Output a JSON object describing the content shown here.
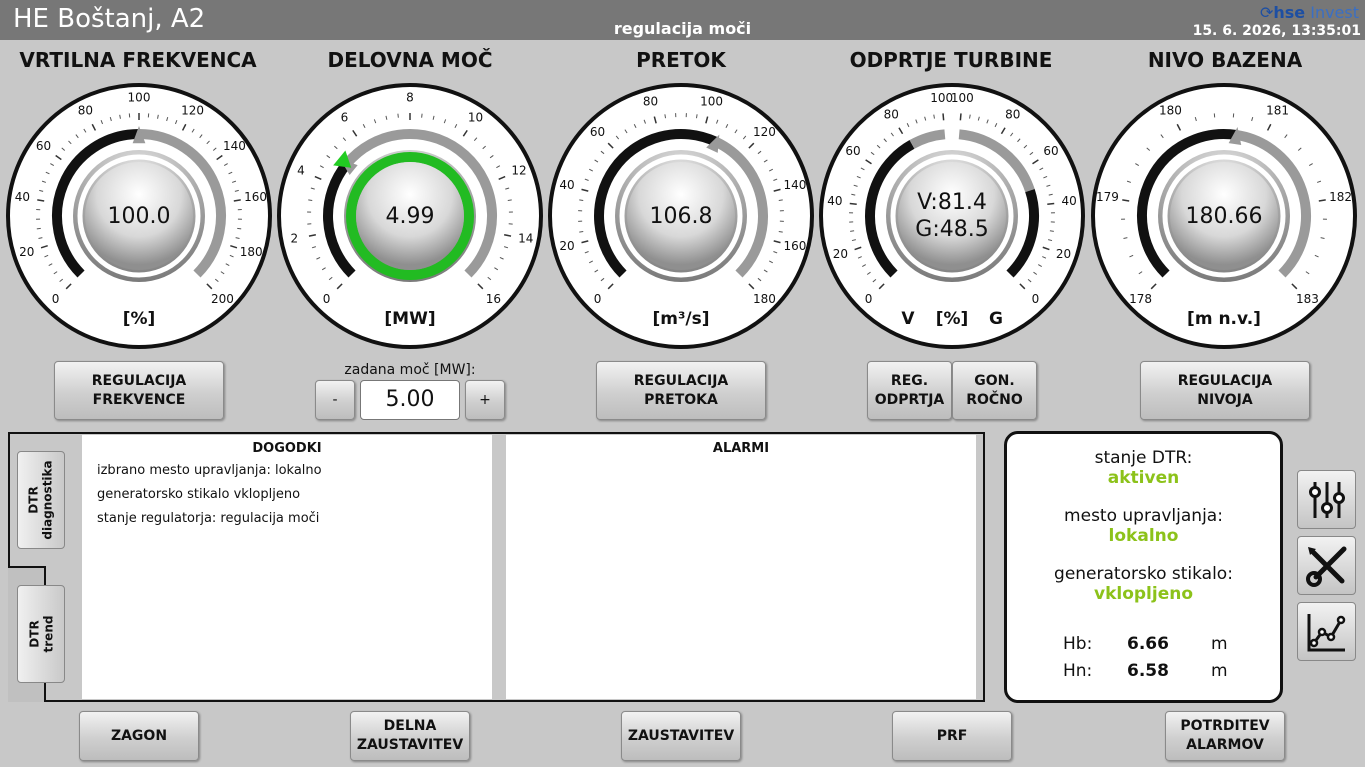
{
  "header": {
    "app_title": "HE Boštanj, A2",
    "screen_title": "regulacija moči",
    "logo_hse": "hse",
    "logo_invest": "Invest",
    "datetime": "15. 6. 2026, 13:35:01"
  },
  "gauges": [
    {
      "title": "VRTILNA FREKVENCA",
      "readout": "100.0",
      "unit": "[%]",
      "ticks": [
        "0",
        "20",
        "40",
        "60",
        "80",
        "100",
        "120",
        "140",
        "160",
        "180",
        "200"
      ],
      "min": 0,
      "max": 200,
      "value": 100.0,
      "ring_color": "#ffffff"
    },
    {
      "title": "DELOVNA MOČ",
      "readout": "4.99",
      "unit": "[MW]",
      "ticks": [
        "0",
        "2",
        "4",
        "6",
        "8",
        "10",
        "12",
        "14",
        "16"
      ],
      "min": 0,
      "max": 16,
      "value": 4.99,
      "setpoint": 5.0,
      "ring_color": "#22bb22"
    },
    {
      "title": "PRETOK",
      "readout": "106.8",
      "unit": "[m³/s]",
      "ticks": [
        "0",
        "20",
        "40",
        "60",
        "80",
        "100",
        "120",
        "140",
        "160",
        "180"
      ],
      "min": 0,
      "max": 180,
      "value": 106.8,
      "ring_color": "#ffffff"
    },
    {
      "title": "ODPRTJE TURBINE",
      "readout_v": "V:81.4",
      "readout_g": "G:48.5",
      "unit_v": "V",
      "unit": "[%]",
      "unit_g": "G",
      "ticks_left": [
        "0",
        "20",
        "40",
        "60",
        "80",
        "100"
      ],
      "ticks_right": [
        "100",
        "80",
        "60",
        "40",
        "20",
        "0"
      ],
      "value_v": 81.4,
      "value_g": 48.5,
      "ring_color": "#ffffff"
    },
    {
      "title": "NIVO BAZENA",
      "readout": "180.66",
      "unit": "[m n.v.]",
      "ticks": [
        "178",
        "179",
        "180",
        "181",
        "182",
        "183"
      ],
      "min": 178,
      "max": 183,
      "value": 180.66,
      "ring_color": "#ffffff"
    }
  ],
  "controls": {
    "reg_frekvence": "REGULACIJA\nFREKVENCE",
    "setpoint_label": "zadana moč [MW]:",
    "setpoint_value": "5.00",
    "minus": "-",
    "plus": "+",
    "reg_pretoka": "REGULACIJA\nPRETOKA",
    "reg_odprtja": "REG.\nODPRTJA",
    "gon_rocno": "GON.\nROČNO",
    "reg_nivoja": "REGULACIJA\nNIVOJA"
  },
  "tabs": {
    "diagnostika": "DTR\ndiagnostika",
    "trend": "DTR\ntrend"
  },
  "events": {
    "header": "DOGODKI",
    "rows": [
      "izbrano mesto upravljanja: lokalno",
      "generatorsko stikalo vklopljeno",
      "stanje regulatorja: regulacija moči"
    ]
  },
  "alarms": {
    "header": "ALARMI",
    "rows": []
  },
  "status": {
    "dtr_label": "stanje DTR:",
    "dtr_value": "aktiven",
    "mesto_label": "mesto upravljanja:",
    "mesto_value": "lokalno",
    "stikalo_label": "generatorsko stikalo:",
    "stikalo_value": "vklopljeno",
    "hb_label": "Hb:",
    "hb_value": "6.66",
    "hb_unit": "m",
    "hn_label": "Hn:",
    "hn_value": "6.58",
    "hn_unit": "m"
  },
  "bottom_buttons": {
    "zagon": "ZAGON",
    "delna": "DELNA\nZAUSTAVITEV",
    "zaustavitev": "ZAUSTAVITEV",
    "prf": "PRF",
    "potrditev": "POTRDITEV\nALARMOV"
  },
  "side_icons": [
    "sliders-icon",
    "tools-icon",
    "trend-chart-icon"
  ]
}
